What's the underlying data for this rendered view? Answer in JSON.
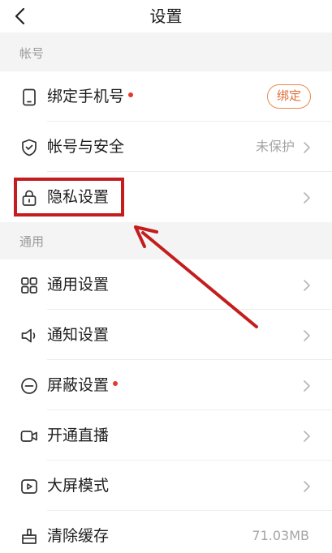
{
  "header": {
    "title": "设置",
    "back_icon": "chevron-left-icon"
  },
  "sections": [
    {
      "label": "帐号"
    },
    {
      "label": "通用"
    }
  ],
  "account_items": [
    {
      "label": "绑定手机号",
      "icon": "phone-icon",
      "has_red_dot": true,
      "action_label": "绑定"
    },
    {
      "label": "帐号与安全",
      "icon": "shield-icon",
      "value": "未保护"
    },
    {
      "label": "隐私设置",
      "icon": "lock-icon"
    }
  ],
  "general_items": [
    {
      "label": "通用设置",
      "icon": "grid-icon"
    },
    {
      "label": "通知设置",
      "icon": "speaker-icon"
    },
    {
      "label": "屏蔽设置",
      "icon": "block-icon",
      "has_red_dot": true
    },
    {
      "label": "开通直播",
      "icon": "video-camera-icon"
    },
    {
      "label": "大屏模式",
      "icon": "tv-play-icon"
    },
    {
      "label": "清除缓存",
      "icon": "broom-icon",
      "value": "71.03MB"
    }
  ],
  "colors": {
    "accent": "#e0703a",
    "red_dot": "#e33a2d",
    "annotation": "#c41d1d",
    "background": "#f4f4f4"
  }
}
